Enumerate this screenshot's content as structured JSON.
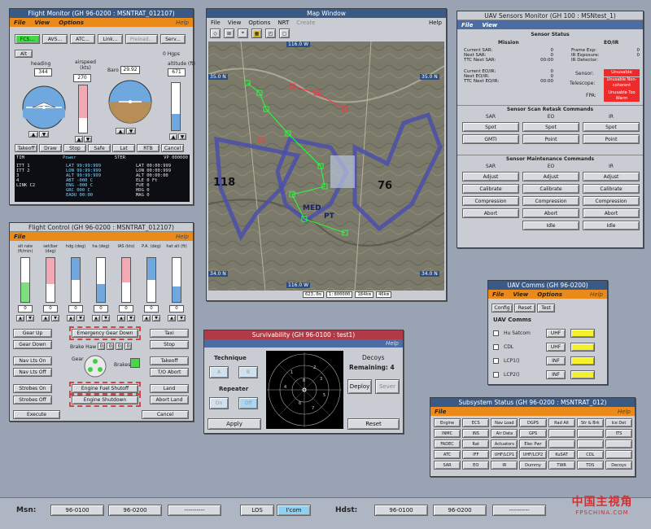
{
  "flight_monitor": {
    "title": "Flight Monitor (GH 96-0200 : MSNTRAT_012107)",
    "menu": [
      "File",
      "View",
      "Options"
    ],
    "help": "Help",
    "buttons": [
      "FCS...",
      "AVS...",
      "ATC...",
      "Link...",
      "Preload...",
      "Serv..."
    ],
    "alt_btn": "Alt",
    "hgps": "0 Hgps",
    "g_labels": [
      "heading",
      "airspeed (kts)",
      "",
      "altitude (ft)"
    ],
    "heading_val": "344",
    "airspeed_val": "270",
    "baro_label": "Baro",
    "baro_val": "29.92",
    "altitude_val": "671",
    "lower_buttons": [
      "Takeoff",
      "Draw",
      "Stop",
      "Safe",
      "Lat",
      "RTB",
      "Cancel"
    ],
    "pane_header": [
      "TIM",
      "Power",
      "STER",
      "VP 000000"
    ],
    "pane_left": [
      "ITT  1",
      "ITT  2",
      "     3",
      "     4",
      "LINK C2"
    ],
    "pane_mid": [
      "LAT  99:99:999",
      "LON  99:99:999",
      "ALT  99:99:999",
      "ABT   -000 C",
      "ENG  -000 C",
      "GRC  000 C",
      "EADU  00:00"
    ],
    "pane_right": [
      "LAT   00:00:999",
      "LON   00:00:999",
      "ALT   00:00:00",
      "ELE   0 Ft",
      "FUE   0",
      "HDG   0",
      "MAG   0"
    ]
  },
  "map": {
    "title": "Map Window",
    "menu": [
      "File",
      "View",
      "Options",
      "NRT",
      "Create"
    ],
    "help": "Help",
    "tb": [
      "wp-icon",
      "route-icon",
      "track-icon",
      "grid-icon",
      "box-icon",
      "box2-icon"
    ],
    "top_lbl": "116.0 W",
    "left_top": "35.0 N",
    "right_top": "35.0 N",
    "left_bot": "34.0 N",
    "right_bot": "34.0 N",
    "bottom_lbl": "116.0 W",
    "status": [
      "623.0m",
      "1:800000",
      "184km",
      "46km"
    ],
    "labels": [
      "118",
      "76",
      "MED",
      "PT"
    ]
  },
  "uav_sensors": {
    "title": "UAV Sensors Monitor (GH 100 : MSNtest_1)",
    "menu": [
      "File",
      "View"
    ],
    "status_title": "Sensor Status",
    "mission": "Mission",
    "eo_ir": "EO/IR",
    "mission_rows": [
      [
        "Current SAR:",
        "0"
      ],
      [
        "Next SAR:",
        "0"
      ],
      [
        "TTC Next SAR:",
        "00:00"
      ],
      [
        "Current EO/IR:",
        "0"
      ],
      [
        "Next EO/IR:",
        "0"
      ],
      [
        "TTC Next EO/IR:",
        "00:00"
      ]
    ],
    "frame_exp_lbl": "Frame Exp:",
    "frame_exp_val": "0",
    "ir_exp_lbl": "IR Exposure:",
    "ir_exp_val": "0",
    "ir_det_lbl": "IR Detector:",
    "sensor_lbl": "Sensor:",
    "telescope_lbl": "Telescope:",
    "fpa_lbl": "FPA:",
    "sensor_v": "Unusable",
    "tele_v": "Unusable Non-coherent",
    "fpa_v": "Unusable Too Warm",
    "retask_title": "Sensor Scan Retask Commands",
    "cols": [
      "SAR",
      "EO",
      "IR"
    ],
    "retask_rows": [
      [
        "Spot",
        "Spot",
        "Spot"
      ],
      [
        "GMTI",
        "Point",
        "Point"
      ]
    ],
    "maint_title": "Sensor Maintenance Commands",
    "maint_rows": [
      [
        "Adjust",
        "Adjust",
        "Adjust"
      ],
      [
        "Calibrate",
        "Calibrate",
        "Calibrate"
      ],
      [
        "Compression",
        "Compression",
        "Compression"
      ],
      [
        "Abort",
        "Abort",
        "Abort"
      ],
      [
        "",
        "Idle",
        "Idle"
      ]
    ]
  },
  "flight_control": {
    "title": "Flight Control (GH 96-0200 : MSNTRAT_012107)",
    "menu": [
      "File"
    ],
    "help": "Help",
    "col_labels": [
      "alt rate (ft/min)",
      "set/bar (deg)",
      "hdg (deg)",
      "ha (deg)",
      "IAS (kts)",
      "P.A. (deg)",
      "hat alt (ft)"
    ],
    "vals": [
      "0",
      "0",
      "0",
      "0",
      "0",
      "0",
      "0"
    ],
    "brake_lbl": "Brake Haw",
    "brake_vals": [
      "0",
      "0",
      "0",
      "0"
    ],
    "gear_lbl": "Gear",
    "brakes_lbl": "Brakes",
    "left_btns": [
      [
        "Gear Up",
        "Emergency Gear Down"
      ],
      [
        "Gear Down",
        ""
      ],
      [
        "Nav Lts On",
        ""
      ],
      [
        "Nav Lts Off",
        ""
      ],
      [
        "Strobes On",
        "Engine Fuel Shutoff"
      ],
      [
        "Strobes Off",
        "Engine Shutdown"
      ]
    ],
    "right_btns": [
      "Taxi",
      "Stop",
      "Takeoff",
      "T/O Abort",
      "Land",
      "Abort Land"
    ],
    "execute": "Execute",
    "cancel": "Cancel"
  },
  "survivability": {
    "title": "Survivability (GH 96-0100 : test1)",
    "help": "Help",
    "technique": "Technique",
    "tech_a": "A",
    "tech_b": "B",
    "repeater": "Repeater",
    "rep_on": "On",
    "rep_off": "Off",
    "decoys": "Decoys",
    "remaining": "Remaining: 4",
    "deploy": "Deploy",
    "sever": "Sever",
    "apply": "Apply",
    "reset": "Reset"
  },
  "uav_comms": {
    "title": "UAV Comms (GH 96-0200)",
    "menu": [
      "File",
      "View",
      "Options"
    ],
    "help": "Help",
    "buttons": [
      "Config",
      "Reset",
      "Test"
    ],
    "header": "UAV Comms",
    "rows": [
      [
        "Hu Satcom",
        "UHF",
        ""
      ],
      [
        "CDL",
        "UHF",
        ""
      ],
      [
        "LCP1()",
        "INF",
        ""
      ],
      [
        "LCP2()",
        "INF",
        ""
      ]
    ]
  },
  "subsystem": {
    "title": "Subsystem Status (GH 96-0200 : MSNTRAT_012)",
    "menu": [
      "File"
    ],
    "help": "Help",
    "rows": [
      [
        "Engine",
        "ECS",
        "Nav Load",
        "DGPS",
        "Rad Alt",
        "Str & Brk",
        "Ice Det"
      ],
      [
        "INMC",
        "INS",
        "Air Data",
        "GPS",
        "",
        "",
        "ITS"
      ],
      [
        "FADEC",
        "Rat",
        "Actuators",
        "Elec Pwr",
        "",
        "",
        ""
      ],
      [
        "ATC",
        "IFF",
        "UHF/LCP1",
        "UHF/LCP2",
        "KuSAT",
        "CDL",
        ""
      ],
      [
        "SAR",
        "EO",
        "IR",
        "Dummy",
        "TWR",
        "TDS",
        "Decoys"
      ]
    ]
  },
  "bottom": {
    "msn_lbl": "Msn:",
    "msn": [
      "96-0100",
      "96-0200",
      "----------"
    ],
    "los": "LOS",
    "icom": "I'com",
    "hdst_lbl": "Hdst:",
    "hdst": [
      "96-0100",
      "96-0200",
      "----------"
    ]
  },
  "watermark": {
    "cn": "中国主視角",
    "en": "FPSCHINA.COM"
  }
}
